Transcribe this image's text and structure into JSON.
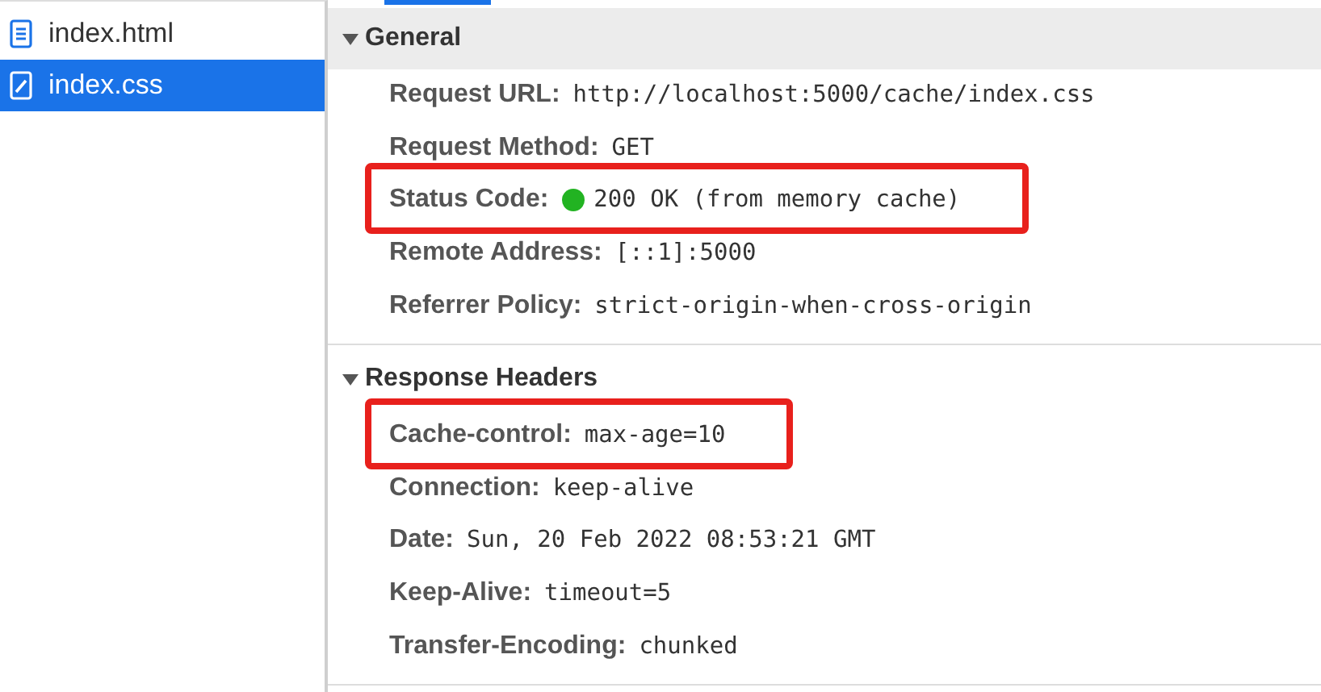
{
  "files": [
    {
      "name": "index.html",
      "kind": "document",
      "selected": false
    },
    {
      "name": "index.css",
      "kind": "stylesheet",
      "selected": true
    }
  ],
  "sections": [
    {
      "title": "General",
      "expanded": true,
      "rows": [
        {
          "label": "Request URL:",
          "value": "http://localhost:5000/cache/index.css",
          "highlighted": false
        },
        {
          "label": "Request Method:",
          "value": "GET",
          "highlighted": false
        },
        {
          "label": "Status Code:",
          "value": "200 OK (from memory cache)",
          "color": "#22b322",
          "highlighted": true
        },
        {
          "label": "Remote Address:",
          "value": "[::1]:5000",
          "highlighted": false
        },
        {
          "label": "Referrer Policy:",
          "value": "strict-origin-when-cross-origin",
          "highlighted": false
        }
      ]
    },
    {
      "title": "Response Headers",
      "expanded": true,
      "rows": [
        {
          "label": "Cache-control:",
          "value": "max-age=10",
          "highlighted": true
        },
        {
          "label": "Connection:",
          "value": "keep-alive",
          "highlighted": false
        },
        {
          "label": "Date:",
          "value": "Sun, 20 Feb 2022 08:53:21 GMT",
          "highlighted": false
        },
        {
          "label": "Keep-Alive:",
          "value": "timeout=5",
          "highlighted": false
        },
        {
          "label": "Transfer-Encoding:",
          "value": "chunked",
          "highlighted": false
        }
      ]
    }
  ]
}
